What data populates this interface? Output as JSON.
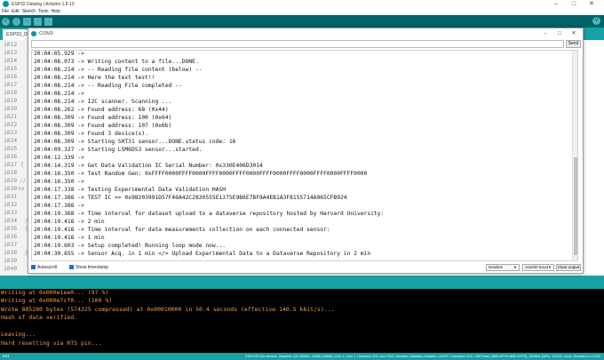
{
  "ide": {
    "title": "ESP32 Datalog | Arduino 1.8.13",
    "menu": [
      "File",
      "Edit",
      "Sketch",
      "Tools",
      "Help"
    ],
    "toolbar": {
      "verify_icon": "check-icon",
      "upload_icon": "arrow-right-icon",
      "new_icon": "new-file-icon",
      "open_icon": "arrow-up-icon",
      "save_icon": "arrow-down-icon",
      "serial_monitor_icon": "magnifier-icon"
    },
    "tab_label": "ESP32_Datalog",
    "line_numbers": [
      "1012",
      "1013",
      "1014",
      "1015",
      "1016",
      "1017",
      "1018",
      "1019",
      "1020",
      "1021",
      "1022",
      "1023",
      "1024",
      "1025",
      "1026",
      "1027",
      "1028",
      "1029",
      "1030",
      "1031",
      "1032",
      "1033",
      "1034",
      "1035",
      "1036",
      "1037",
      "1038",
      "1039",
      "1040"
    ],
    "code_fragments": [
      "{",
      "//",
      "vo",
      "/",
      "{",
      "}"
    ],
    "colors": {
      "toolbar": "#006468",
      "tabbar": "#17a1a5",
      "console_text": "#f29d52"
    }
  },
  "serial_monitor": {
    "title": "COM3",
    "send_label": "Send",
    "send_value": "",
    "lines": [
      "20:04:05.929 ->",
      "20:04:06.073 -> Writing content to a file...DONE.",
      "20:04:06.214 -> -- Reading file content (below) --",
      "20:04:06.214 -> Here the text test!!",
      "20:04:06.214 -> -- Reading File completed --",
      "20:04:06.214 ->",
      "20:04:06.214 -> I2C scanner. Scanning ...",
      "20:04:06.262 -> Found address: 68 (0x44)",
      "20:04:06.309 -> Found address: 100 (0x64)",
      "20:04:06.309 -> Found address: 107 (0x6b)",
      "20:04:06.309 -> Found 3 device(s).",
      "20:04:06.309 -> Starting SHT31 sensor...DONE.status code: 16",
      "20:04:09.327 -> Starting LSM6DS3 sensor...started.",
      "20:04:12.339 ->",
      "20:04:14.319 -> Get Data Validation IC Serial Number: 0x330E406D3014",
      "20:04:16.350 -> Test Random Gen: 0xFFFF0000FFFF0000FFFF0000FFFF0000FFFF0000FFFF0000FFFF0000FFFF0000",
      "20:04:16.350 ->",
      "20:04:17.338 -> Testing Experimental Data Validation HASH",
      "20:04:17.386 -> TEST IC => 0x98203991D57F46A42C2830555E1375E9B6E7BF8A4EB1A3F8155714A965CFB924",
      "20:04:17.386 ->",
      "20:04:19.368 -> Time interval for dataset upload to a dataverse repository hosted by Harvard University:",
      "20:04:19.416 -> 2 min",
      "20:04:19.416 -> Time interval for data measurements collection on each connected sensor:",
      "20:04:19.416 -> 1 min",
      "20:04:19.603 -> Setup completed! Running loop mode now...",
      "20:04:30.655 -> Sensor Acq. in 1 min </> Upload Experimental Data to a Dataverse Repository in 2 min"
    ],
    "autoscroll_label": "Autoscroll",
    "autoscroll_checked": true,
    "timestamp_label": "Show timestamp",
    "timestamp_checked": true,
    "line_ending": "Newline",
    "baud_rate": "115200 baud",
    "clear_label": "Clear output"
  },
  "console": {
    "lines": [
      "Writing at 0x000e1ee0... (97 %)",
      "Writing at 0x000e7cf0... (100 %)",
      "Wrote 885280 bytes (574325 compressed) at 0x00010000 in 50.4 seconds (effective 140.5 kbit/s)...",
      "Hash of data verified.",
      "",
      "Leaving...",
      "Hard resetting via RTS pin..."
    ]
  },
  "statusbar": {
    "left": "941",
    "right": "ESP32S3 Dev Module, Disabled, QIO 80MHz, 16MB (128Mb), Core 1, Core 1, Hardware CDC and JTAG, Disabled, Disabled, Disabled, UART0 / Hardware CDC, 16M Flash (3MB APP/9.9MB FATFS), 240MHz (WiFi), 115200, None, Disabled on COM3"
  }
}
